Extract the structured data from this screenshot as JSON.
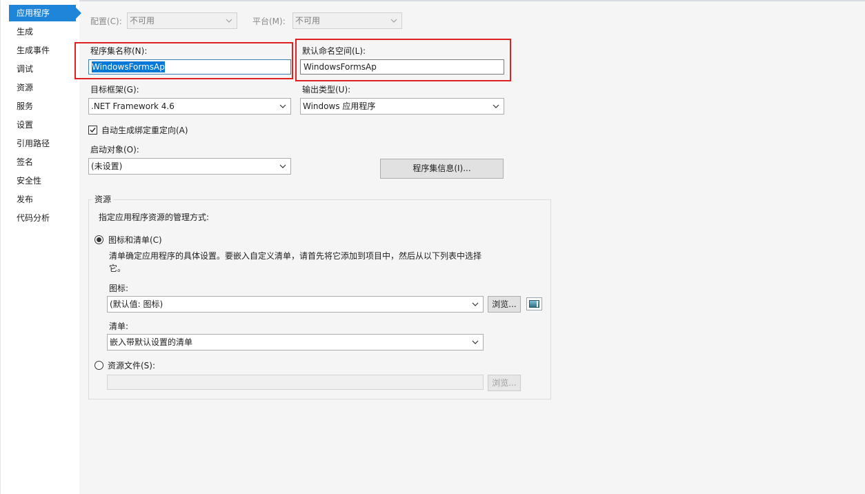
{
  "sidebar": {
    "items": [
      {
        "label": "应用程序"
      },
      {
        "label": "生成"
      },
      {
        "label": "生成事件"
      },
      {
        "label": "调试"
      },
      {
        "label": "资源"
      },
      {
        "label": "服务"
      },
      {
        "label": "设置"
      },
      {
        "label": "引用路径"
      },
      {
        "label": "签名"
      },
      {
        "label": "安全性"
      },
      {
        "label": "发布"
      },
      {
        "label": "代码分析"
      }
    ],
    "active_index": 0,
    "accent_color": "#1e85d8"
  },
  "toolbar": {
    "config_label": "配置(C):",
    "config_value": "不可用",
    "platform_label": "平台(M):",
    "platform_value": "不可用"
  },
  "assembly": {
    "name_label": "程序集名称(N):",
    "name_value": "WindowsFormsAp",
    "namespace_label": "默认命名空间(L):",
    "namespace_value": "WindowsFormsAp",
    "highlight_color": "#e02020"
  },
  "framework": {
    "target_label": "目标框架(G):",
    "target_value": ".NET Framework 4.6",
    "output_label": "输出类型(U):",
    "output_value": "Windows 应用程序"
  },
  "auto_binding": {
    "label": "自动生成绑定重定向(A)",
    "checked": true
  },
  "startup": {
    "label": "启动对象(O):",
    "value": "(未设置)",
    "assembly_info_button": "程序集信息(I)..."
  },
  "resources": {
    "group_title": "资源",
    "instruction": "指定应用程序资源的管理方式:",
    "icon_manifest_option": "图标和清单(C)",
    "description": "清单确定应用程序的具体设置。要嵌入自定义清单，请首先将它添加到项目中，然后从以下列表中选择它。",
    "icon_label": "图标:",
    "icon_value": "(默认值: 图标)",
    "browse_label": "浏览...",
    "manifest_label": "清单:",
    "manifest_value": "嵌入带默认设置的清单",
    "resource_file_option": "资源文件(S):",
    "resource_file_value": "",
    "resource_browse_label": "浏览..."
  }
}
